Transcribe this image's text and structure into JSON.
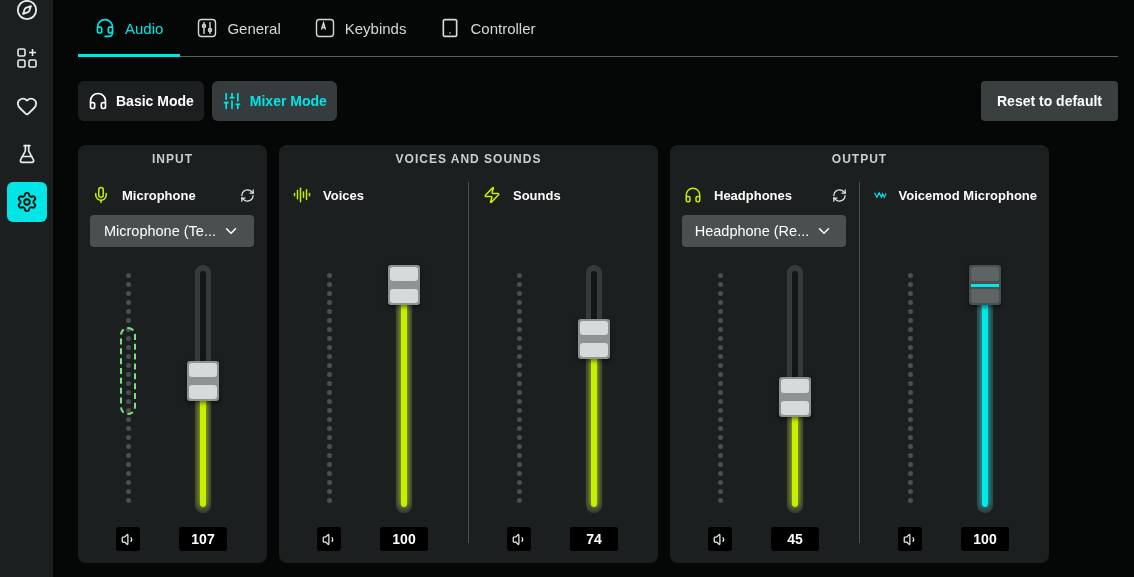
{
  "sidebar": {
    "items": [
      {
        "selected": false
      },
      {
        "selected": false
      },
      {
        "selected": false
      },
      {
        "selected": false
      },
      {
        "selected": true
      }
    ]
  },
  "tabs": [
    {
      "label": "Audio",
      "selected": true
    },
    {
      "label": "General",
      "selected": false
    },
    {
      "label": "Keybinds",
      "selected": false
    },
    {
      "label": "Controller",
      "selected": false
    }
  ],
  "modes": [
    {
      "label": "Basic Mode",
      "selected": false
    },
    {
      "label": "Mixer Mode",
      "selected": true
    }
  ],
  "reset_button": "Reset to default",
  "groups": [
    {
      "title": "INPUT",
      "channels": [
        {
          "kind": "physical",
          "name": "Microphone",
          "device": "Microphone (Te...",
          "color": "#c6f000",
          "threshold_marker": true,
          "level": 0.54,
          "value": "107"
        }
      ]
    },
    {
      "title": "VOICES AND SOUNDS",
      "channels": [
        {
          "kind": "physical",
          "name": "Voices",
          "color": "#c6f000",
          "threshold_marker": false,
          "level": 1,
          "value": "100"
        },
        {
          "kind": "physical",
          "name": "Sounds",
          "color": "#c6f000",
          "threshold_marker": false,
          "level": 0.74,
          "value": "74"
        }
      ]
    },
    {
      "title": "OUTPUT",
      "channels": [
        {
          "kind": "physical",
          "name": "Headphones",
          "device": "Headphone (Re...",
          "color": "#c6f000",
          "threshold_marker": false,
          "level": 0.46,
          "value": "45"
        },
        {
          "kind": "virtual",
          "name": "Voicemod Microphone",
          "color": "#00e8e8",
          "threshold_marker": false,
          "level": 1,
          "value": "100"
        }
      ]
    }
  ]
}
